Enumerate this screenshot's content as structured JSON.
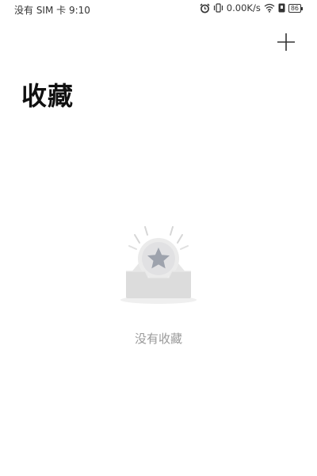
{
  "status_bar": {
    "left_text": "没有 SIM 卡 9:10",
    "net_speed": "0.00K/s",
    "battery_level": "86",
    "icons": [
      "alarm-icon",
      "vibrate-icon",
      "wifi-icon",
      "sim-status-icon",
      "battery-icon"
    ]
  },
  "header": {
    "title": "收藏",
    "add_icon": "plus-icon"
  },
  "empty_state": {
    "message": "没有收藏",
    "illustration": "star-inbox-icon"
  },
  "colors": {
    "background": "#ffffff",
    "title": "#111111",
    "empty_text": "#9a9a9a",
    "illustration_gray": "#dcdcdc",
    "star_gray": "#9ea3ad"
  }
}
